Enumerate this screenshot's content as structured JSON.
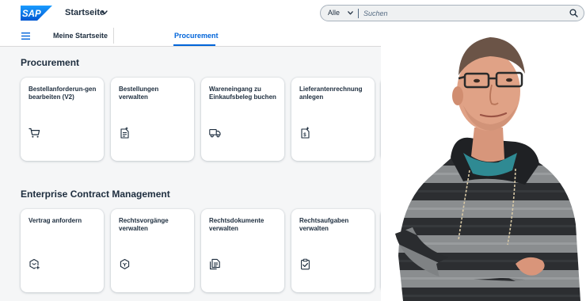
{
  "shell": {
    "brand": "SAP",
    "home_title": "Startseite",
    "search": {
      "scope": "Alle",
      "placeholder": "Suchen",
      "value": ""
    }
  },
  "nav": {
    "tabs": [
      {
        "label": "Meine Startseite",
        "active": false
      },
      {
        "label": "Procurement",
        "active": true
      }
    ]
  },
  "sections": [
    {
      "title": "Procurement",
      "tiles": [
        {
          "title": "Bestellanforderun-gen bearbeiten (V2)",
          "icon": "cart-icon"
        },
        {
          "title": "Bestellungen verwalten",
          "icon": "document-list-icon"
        },
        {
          "title": "Wareneingang zu Einkaufsbeleg buchen",
          "icon": "truck-icon"
        },
        {
          "title": "Lieferantenrechnung anlegen",
          "icon": "invoice-add-icon"
        }
      ]
    },
    {
      "title": "Enterprise Contract Management",
      "tiles": [
        {
          "title": "Vertrag anfordern",
          "icon": "contract-request-icon"
        },
        {
          "title": "Rechtsvorgänge verwalten",
          "icon": "legal-transaction-icon"
        },
        {
          "title": "Rechtsdokumente verwalten",
          "icon": "legal-documents-icon"
        },
        {
          "title": "Rechtsaufgaben verwalten",
          "icon": "task-clipboard-icon"
        }
      ]
    }
  ],
  "colors": {
    "accent": "#0064d9",
    "brand_blue": "#0070f2",
    "background": "#f5f6f7",
    "text": "#1d2d3e"
  }
}
